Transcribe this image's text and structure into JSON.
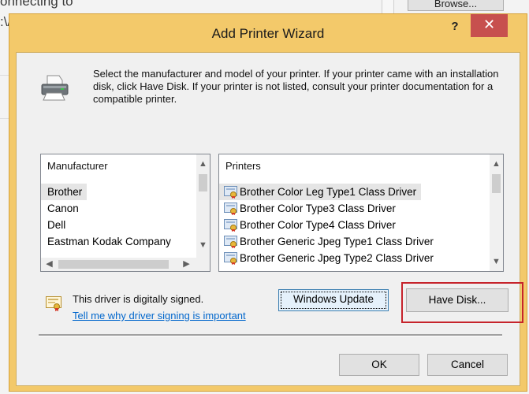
{
  "background": {
    "partial_text_1": "onnecting to",
    "partial_text_2": ":\\/",
    "browse_button": "Browse..."
  },
  "dialog": {
    "title": "Add Printer Wizard",
    "help": "?",
    "close": "✕"
  },
  "intro": "Select the manufacturer and model of your printer. If your printer came with an installation disk, click Have Disk. If your printer is not listed, consult your printer documentation for a compatible printer.",
  "manufacturer_list": {
    "header": "Manufacturer",
    "items": [
      "Brother",
      "Canon",
      "Dell",
      "Eastman Kodak Company"
    ],
    "selected": "Brother"
  },
  "printers_list": {
    "header": "Printers",
    "items": [
      "Brother Color Leg Type1 Class Driver",
      "Brother Color Type3 Class Driver",
      "Brother Color Type4 Class Driver",
      "Brother Generic Jpeg Type1 Class Driver",
      "Brother Generic Jpeg Type2 Class Driver"
    ]
  },
  "signed_text": "This driver is digitally signed.",
  "signed_link": "Tell me why driver signing is important",
  "buttons": {
    "windows_update": "Windows Update",
    "have_disk": "Have Disk...",
    "ok": "OK",
    "cancel": "Cancel"
  },
  "colors": {
    "title_bar": "#f3c96a",
    "close_button": "#c7504e",
    "link": "#0066cc",
    "highlight_box": "#c6232b"
  },
  "icons": [
    "printer-icon",
    "driver-icon",
    "certificate-icon",
    "scroll-arrow-icons"
  ]
}
